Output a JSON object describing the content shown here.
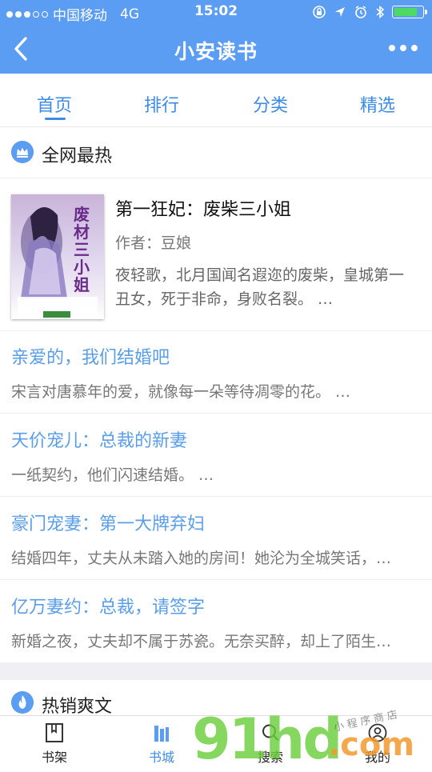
{
  "status_bar": {
    "carrier": "中国移动",
    "network": "4G",
    "time": "15:02"
  },
  "nav": {
    "title": "小安读书"
  },
  "tabs": [
    {
      "label": "首页",
      "active": true
    },
    {
      "label": "排行",
      "active": false
    },
    {
      "label": "分类",
      "active": false
    },
    {
      "label": "精选",
      "active": false
    }
  ],
  "section_hot": {
    "title": "全网最热",
    "icon": "crown-icon"
  },
  "featured": {
    "title": "第一狂妃：废柴三小姐",
    "author": "作者：豆娘",
    "description": "夜轻歌，北月国闻名遐迩的废柴，皇城第一丑女，死于非命，身败名裂。 …",
    "cover_text": "废材三小姐"
  },
  "books": [
    {
      "title": "亲爱的，我们结婚吧",
      "desc": "宋言对唐慕年的爱，就像每一朵等待凋零的花。 …"
    },
    {
      "title": "天价宠儿：总裁的新妻",
      "desc": "一纸契约，他们闪速结婚。 …"
    },
    {
      "title": "豪门宠妻：第一大牌弃妇",
      "desc": "结婚四年，丈夫从未踏入她的房间！她沦为全城笑话，…"
    },
    {
      "title": "亿万妻约：总裁，请签字",
      "desc": "新婚之夜，丈夫却不属于苏瓷。无奈买醉，却上了陌生…"
    }
  ],
  "section_bestseller": {
    "title": "热销爽文",
    "icon": "flame-icon"
  },
  "bottom_tabs": [
    {
      "label": "书架",
      "icon": "bookshelf-icon",
      "active": false
    },
    {
      "label": "书城",
      "icon": "bookstore-icon",
      "active": true
    },
    {
      "label": "搜索",
      "icon": "search-icon",
      "active": false
    },
    {
      "label": "我的",
      "icon": "profile-icon",
      "active": false
    }
  ],
  "colors": {
    "primary": "#5b9df2",
    "accent": "#3d8be6",
    "link": "#5a9ee8"
  },
  "watermark": {
    "text": "91hd",
    "domain": ".com",
    "caption": "小程序商店"
  }
}
